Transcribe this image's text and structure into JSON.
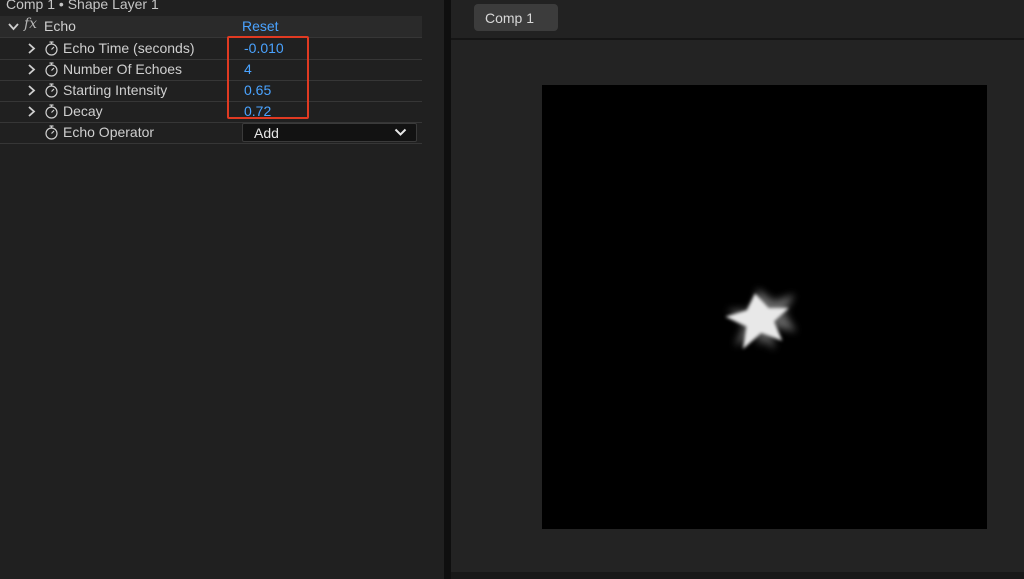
{
  "panel": {
    "title": "Comp 1 • Shape Layer 1"
  },
  "effect": {
    "name": "Echo",
    "fx_label": "fx",
    "reset_label": "Reset",
    "properties": [
      {
        "label": "Echo Time (seconds)",
        "value": "-0.010"
      },
      {
        "label": "Number Of Echoes",
        "value": "4"
      },
      {
        "label": "Starting Intensity",
        "value": "0.65"
      },
      {
        "label": "Decay",
        "value": "0.72"
      }
    ],
    "operator": {
      "label": "Echo Operator",
      "selected": "Add"
    }
  },
  "viewer": {
    "tab_label": "Comp 1"
  },
  "colors": {
    "value_blue": "#4aa3ff",
    "highlight_red": "#e03a22",
    "canvas_bg": "#000000"
  },
  "icons": {
    "expand": "chevron-right-icon",
    "collapse": "chevron-down-icon",
    "keyframe": "stopwatch-icon",
    "dropdown": "chevron-down-icon"
  }
}
